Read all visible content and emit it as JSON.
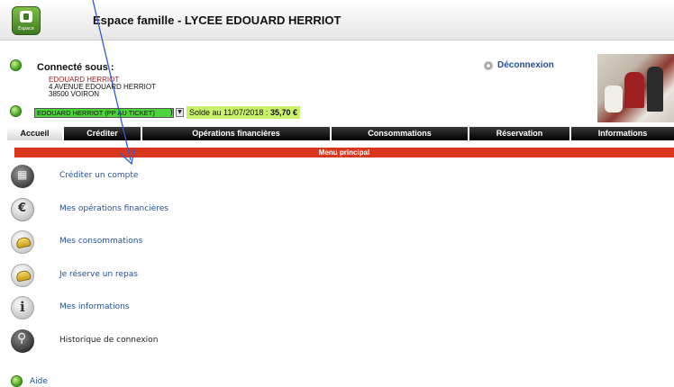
{
  "header": {
    "title": "Espace famille - LYCEE EDOUARD HERRIOT",
    "logo_caption": "Espace"
  },
  "session": {
    "connected_label": "Connecté sous :",
    "user_name": "EDOUARD HERRIOT",
    "address_line1": "4 AVENUE EDOUARD HERRIOT",
    "address_line2": "38500 VOIRON",
    "logout_label": "Déconnexion"
  },
  "account": {
    "selected": "EDOUARD HERRIOT (PP AU TICKET)",
    "selected_tail": ")",
    "balance_label": "Solde au 11/07/2018 :",
    "balance_value": "35,70 €"
  },
  "nav": {
    "tabs": [
      {
        "label": "Accueil",
        "active": true
      },
      {
        "label": "Créditer",
        "active": false
      },
      {
        "label": "Opérations financières",
        "active": false
      },
      {
        "label": "Consommations",
        "active": false
      },
      {
        "label": "Réservation",
        "active": false
      },
      {
        "label": "Informations",
        "active": false
      }
    ]
  },
  "menu": {
    "title": "Menu principal",
    "items": [
      {
        "label": "Créditer un compte",
        "icon": "cart-icon"
      },
      {
        "label": "Mes opérations financières",
        "icon": "euro-icon"
      },
      {
        "label": "Mes consommations",
        "icon": "bread-icon"
      },
      {
        "label": "Je réserve un repas",
        "icon": "bread-icon"
      },
      {
        "label": "Mes informations",
        "icon": "info-icon"
      },
      {
        "label": "Historique de connexion",
        "icon": "history-icon"
      }
    ]
  },
  "footer": {
    "help_label": "Aide"
  },
  "colors": {
    "accent_red": "#d9361e",
    "link_blue": "#1f4f9a",
    "select_green": "#4cd43a",
    "balance_green": "#c9f16b"
  }
}
